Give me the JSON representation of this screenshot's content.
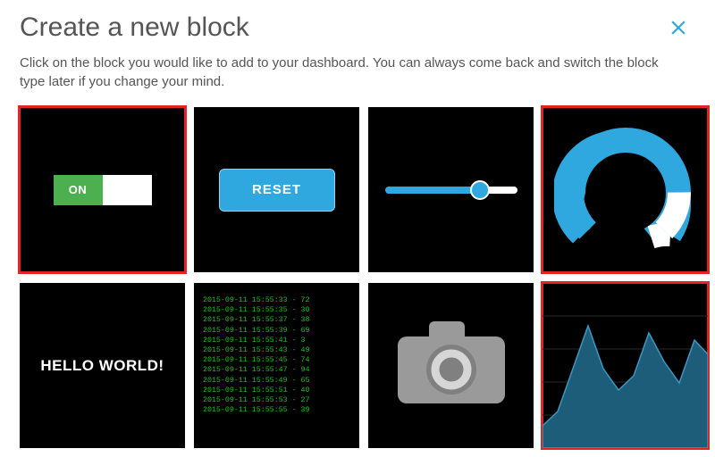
{
  "header": {
    "title": "Create a new block",
    "subtitle": "Click on the block you would like to add to your dashboard. You can always come back and switch the block type later if you change your mind.",
    "close_icon": "close-icon"
  },
  "colors": {
    "accent": "#2fa8e0",
    "highlight": "#e22424",
    "toggle_on": "#4caf50",
    "terminal_text": "#16c21d"
  },
  "blocks": [
    {
      "id": "toggle",
      "highlighted": true,
      "toggle_label": "ON"
    },
    {
      "id": "button",
      "highlighted": false,
      "button_label": "RESET"
    },
    {
      "id": "slider",
      "highlighted": false,
      "slider_value": 70
    },
    {
      "id": "gauge",
      "highlighted": true,
      "gauge_value": 80
    },
    {
      "id": "text",
      "highlighted": false,
      "text_content": "HELLO WORLD!"
    },
    {
      "id": "stream",
      "highlighted": false,
      "stream_lines": [
        "2015-09-11 15:55:33 - 72",
        "2015-09-11 15:55:35 - 30",
        "2015-09-11 15:55:37 - 38",
        "2015-09-11 15:55:39 - 69",
        "2015-09-11 15:55:41 - 3",
        "2015-09-11 15:55:43 - 49",
        "2015-09-11 15:55:45 - 74",
        "2015-09-11 15:55:47 - 94",
        "2015-09-11 15:55:49 - 65",
        "2015-09-11 15:55:51 - 40",
        "2015-09-11 15:55:53 - 27",
        "2015-09-11 15:55:55 - 39"
      ]
    },
    {
      "id": "image",
      "highlighted": false
    },
    {
      "id": "linechart",
      "highlighted": true
    }
  ],
  "chart_data": {
    "type": "area",
    "x": [
      0,
      1,
      2,
      3,
      4,
      5,
      6,
      7,
      8,
      9,
      10,
      11
    ],
    "values": [
      20,
      30,
      60,
      90,
      55,
      40,
      50,
      80,
      60,
      45,
      75,
      65
    ],
    "ylim": [
      0,
      100
    ]
  }
}
